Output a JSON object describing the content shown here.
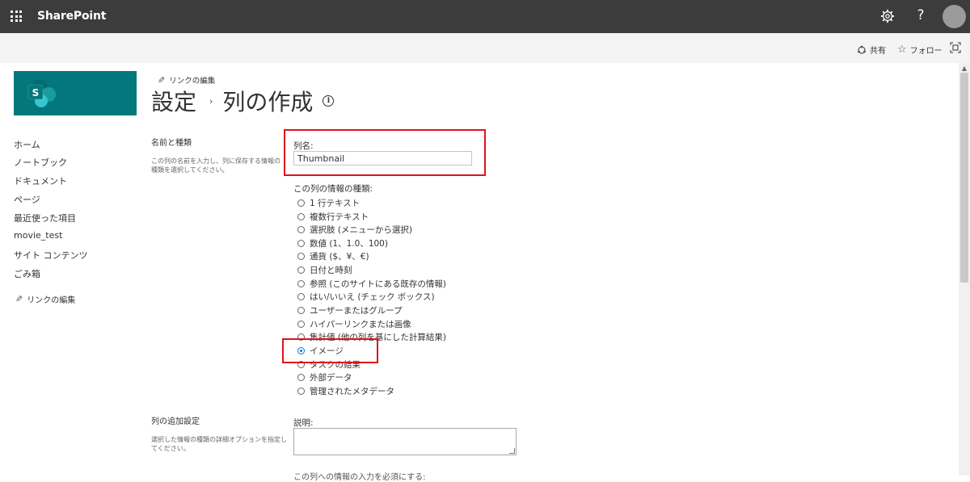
{
  "suitebar": {
    "brand": "SharePoint",
    "help": "?",
    "icons": [
      "app-launcher-icon",
      "gear-icon",
      "help-icon",
      "avatar"
    ]
  },
  "commandbar": {
    "share": "共有",
    "follow": "フォロー"
  },
  "nav": {
    "items": [
      "ホーム",
      "ノートブック",
      "ドキュメント",
      "ページ",
      "最近使った項目",
      "movie_test",
      "サイト コンテンツ",
      "ごみ箱"
    ],
    "edit_links": "リンクの編集"
  },
  "header": {
    "edit_links": "リンクの編集",
    "breadcrumb_parent": "設定",
    "separator": "›",
    "title": "列の作成",
    "info": "i"
  },
  "sections": {
    "name_type": {
      "title": "名前と種類",
      "desc": "この列の名前を入力し、列に保存する情報の種類を選択してください。"
    },
    "additional": {
      "title": "列の追加設定",
      "desc": "選択した情報の種類の詳細オプションを指定してください。"
    }
  },
  "form": {
    "column_name_label": "列名:",
    "column_name_value": "Thumbnail",
    "type_label": "この列の情報の種類:",
    "types": [
      "1 行テキスト",
      "複数行テキスト",
      "選択肢 (メニューから選択)",
      "数値 (1、1.0、100)",
      "通貨 ($、¥、€)",
      "日付と時刻",
      "参照 (このサイトにある既存の情報)",
      "はい/いいえ (チェック ボックス)",
      "ユーザーまたはグループ",
      "ハイパーリンクまたは画像",
      "集計値 (他の列を基にした計算結果)",
      "イメージ",
      "タスクの結果",
      "外部データ",
      "管理されたメタデータ"
    ],
    "selected_type": "イメージ",
    "description_label": "説明:",
    "required_label": "この列への情報の入力を必須にする:"
  },
  "colors": {
    "suitebar": "#3c3c3c",
    "logo": "#03787c",
    "highlight": "#e0111b",
    "radio_selected": "#0078d4"
  }
}
